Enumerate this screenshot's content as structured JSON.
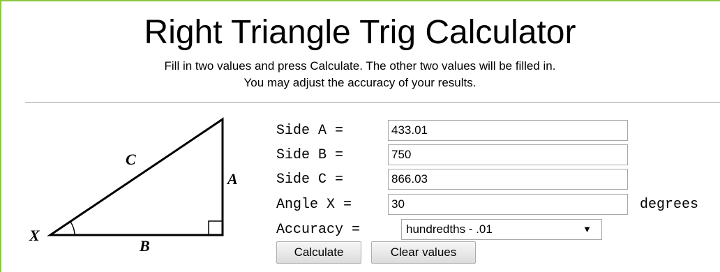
{
  "header": {
    "title": "Right Triangle Trig Calculator",
    "subtitle_line1": "Fill in two values and press Calculate. The other two values will be filled in.",
    "subtitle_line2": "You may adjust the accuracy of your results."
  },
  "diagram": {
    "label_c": "C",
    "label_a": "A",
    "label_x": "X",
    "label_b": "B"
  },
  "form": {
    "side_a_label": "Side A =",
    "side_a_value": "433.01",
    "side_b_label": "Side B =",
    "side_b_value": "750",
    "side_c_label": "Side C =",
    "side_c_value": "866.03",
    "angle_x_label": "Angle X =",
    "angle_x_value": "30",
    "angle_unit": "degrees",
    "accuracy_label": "Accuracy =",
    "accuracy_value": "hundredths - .01",
    "accuracy_arrow": "▼"
  },
  "buttons": {
    "calculate": "Calculate",
    "clear": "Clear values"
  }
}
